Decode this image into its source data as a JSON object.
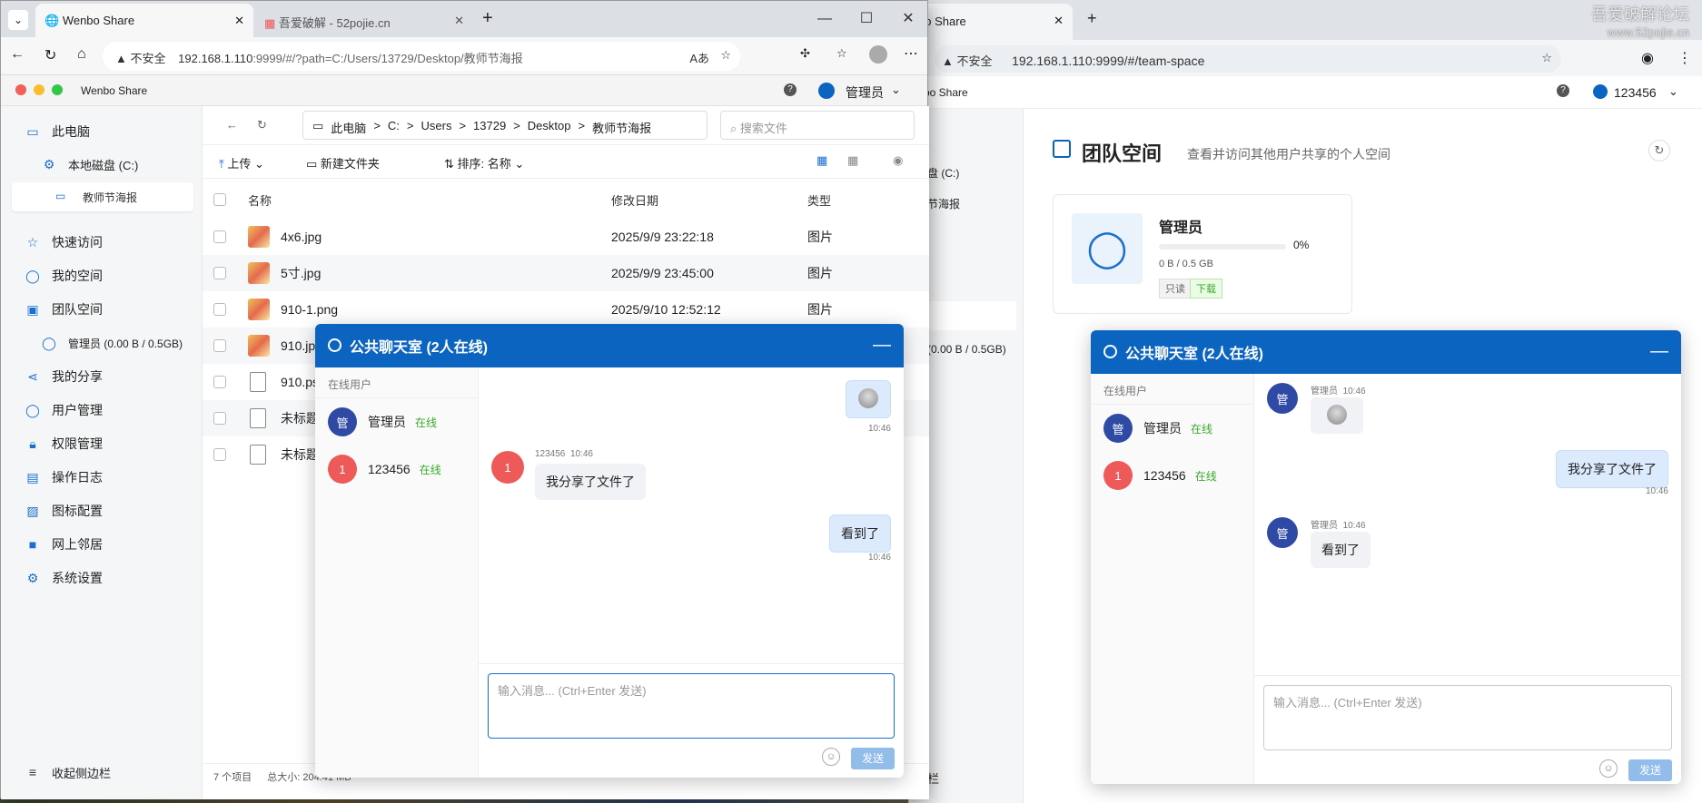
{
  "right_browser": {
    "tab_title": "bo Share",
    "insecure_label": "不安全",
    "url": "192.168.1.110:9999/#/team-space",
    "watermark": "吾爱破解论坛",
    "watermark_site": "www.52pojie.cn",
    "app_title": "bo Share",
    "user": "123456",
    "partial_sidebar": [
      "盘 (C:)",
      "节海报",
      "(0.00 B / 0.5GB)",
      "栏"
    ],
    "page_title": "团队空间",
    "page_subtitle": "查看并访问其他用户共享的个人空间",
    "card": {
      "name": "管理员",
      "percent": "0%",
      "progress": 0,
      "usage": "0 B / 0.5 GB",
      "tag_readonly": "只读",
      "tag_download": "下载"
    },
    "chat": {
      "title": "公共聊天室 (2人在线)",
      "users_header": "在线用户",
      "users": [
        {
          "avatar": "管",
          "name": "管理员",
          "status": "在线"
        },
        {
          "avatar": "1",
          "name": "123456",
          "status": "在线"
        }
      ],
      "messages": [
        {
          "sender": "管理员",
          "time": "10:46",
          "avatar": "管"
        },
        {
          "text": "我分享了文件了",
          "time": "10:46"
        },
        {
          "sender": "管理员",
          "time": "10:46",
          "text": "看到了",
          "avatar": "管"
        }
      ],
      "input_placeholder": "输入消息... (Ctrl+Enter 发送)",
      "send": "发送"
    }
  },
  "left_browser": {
    "tabs": [
      {
        "title": "Wenbo Share"
      },
      {
        "title": "吾爱破解 - 52pojie.cn"
      }
    ],
    "insecure_label": "不安全",
    "url_host": "192.168.1.110",
    "url_rest": ":9999/#/?path=C:/Users/13729/Desktop/教师节海报",
    "app_title": "Wenbo Share",
    "user": "管理员",
    "sidebar": {
      "this_pc": "此电脑",
      "local_disk": "本地磁盘 (C:)",
      "current_folder": "教师节海报",
      "items": [
        "快速访问",
        "我的空间",
        "团队空间"
      ],
      "admin_quota": "管理员 (0.00 B / 0.5GB)",
      "items2": [
        "我的分享",
        "用户管理",
        "权限管理",
        "操作日志",
        "图标配置",
        "网上邻居",
        "系统设置"
      ],
      "collapse": "收起侧边栏"
    },
    "breadcrumb": [
      "此电脑",
      "C:",
      "Users",
      "13729",
      "Desktop",
      "教师节海报"
    ],
    "search_placeholder": "搜索文件",
    "toolbar": {
      "upload": "上传",
      "new_folder": "新建文件夹",
      "sort": "排序: 名称"
    },
    "columns": {
      "name": "名称",
      "date": "修改日期",
      "type": "类型"
    },
    "files": [
      {
        "name": "4x6.jpg",
        "date": "2025/9/9 23:22:18",
        "type": "图片"
      },
      {
        "name": "5寸.jpg",
        "date": "2025/9/9 23:45:00",
        "type": "图片"
      },
      {
        "name": "910-1.png",
        "date": "2025/9/10 12:52:12",
        "type": "图片"
      },
      {
        "name": "910.jp"
      },
      {
        "name": "910.ps"
      },
      {
        "name": "未标题"
      },
      {
        "name": "未标题"
      }
    ],
    "status": {
      "count": "7 个项目",
      "size": "总大小: 204.41 MB"
    },
    "chat": {
      "title": "公共聊天室 (2人在线)",
      "users_header": "在线用户",
      "users": [
        {
          "avatar": "管",
          "name": "管理员",
          "status": "在线"
        },
        {
          "avatar": "1",
          "name": "123456",
          "status": "在线"
        }
      ],
      "messages": [
        {
          "time": "10:46"
        },
        {
          "sender": "123456",
          "time": "10:46",
          "text": "我分享了文件了",
          "avatar": "1"
        },
        {
          "text": "看到了",
          "time": "10:46"
        }
      ],
      "input_placeholder": "输入消息... (Ctrl+Enter 发送)",
      "send": "发送"
    }
  }
}
